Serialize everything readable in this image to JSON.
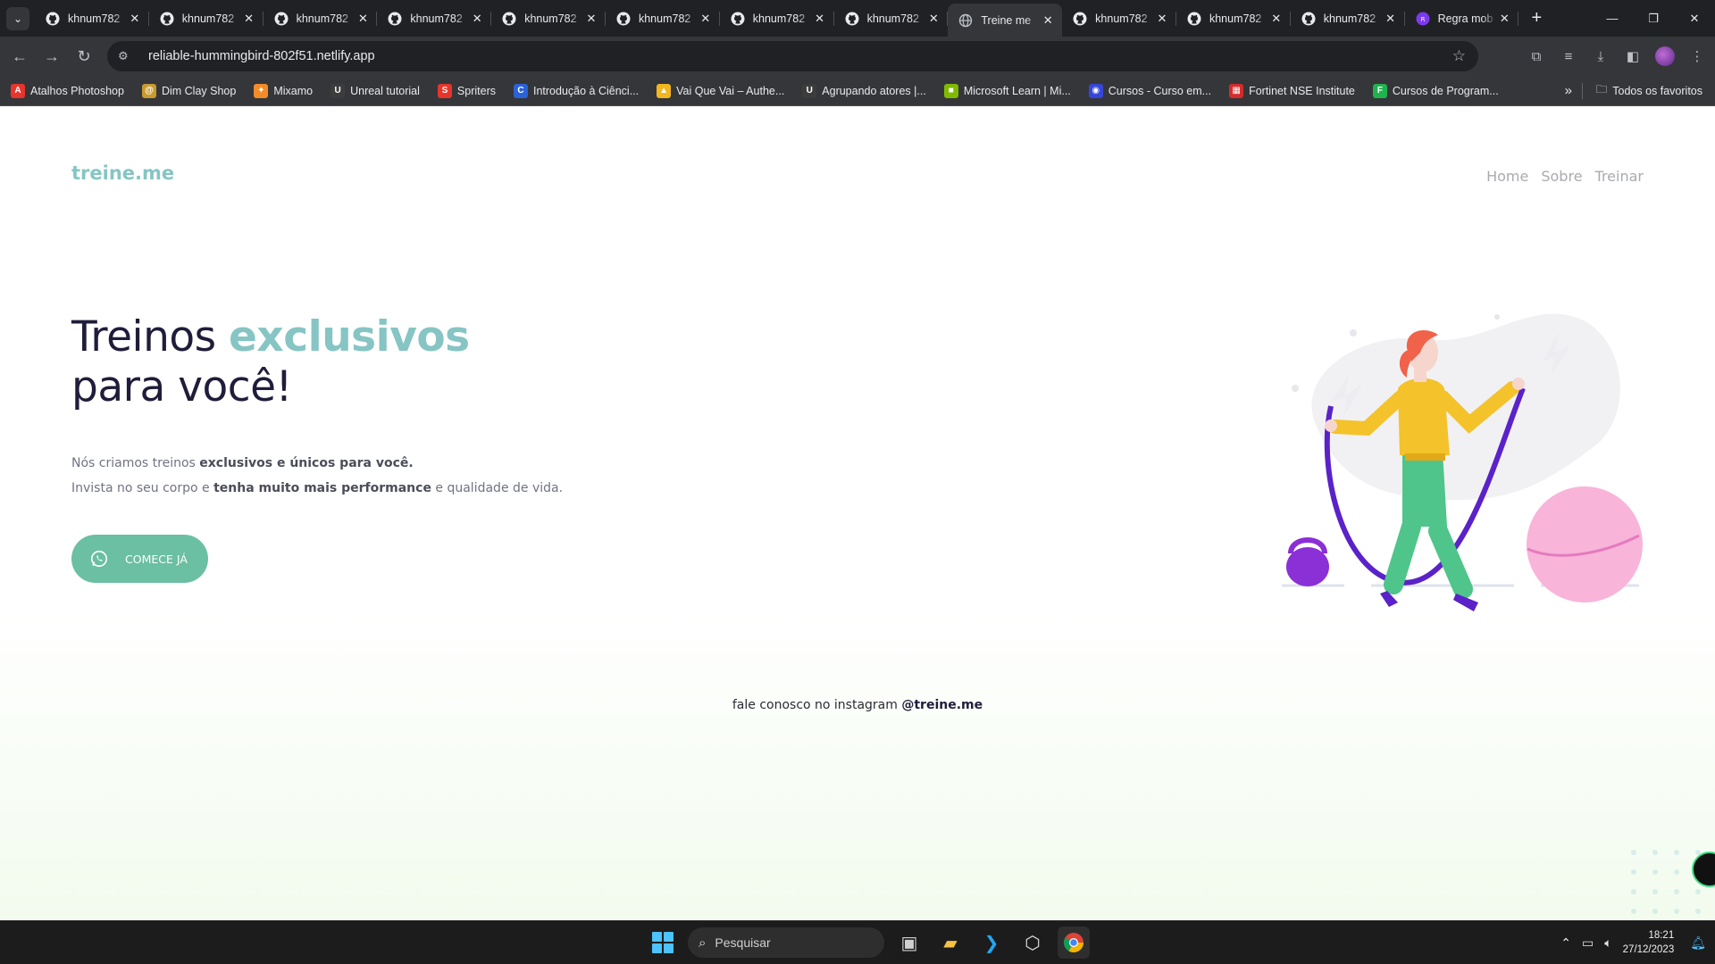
{
  "browser": {
    "tabs": [
      {
        "title": "khnum782",
        "icon": "github-icon",
        "active": false
      },
      {
        "title": "khnum782",
        "icon": "github-icon",
        "active": false
      },
      {
        "title": "khnum782",
        "icon": "github-icon",
        "active": false
      },
      {
        "title": "khnum782",
        "icon": "github-icon",
        "active": false
      },
      {
        "title": "khnum782",
        "icon": "github-icon",
        "active": false
      },
      {
        "title": "khnum782",
        "icon": "github-icon",
        "active": false
      },
      {
        "title": "khnum782",
        "icon": "github-icon",
        "active": false
      },
      {
        "title": "khnum782",
        "icon": "github-icon",
        "active": false
      },
      {
        "title": "Treine me",
        "icon": "globe-icon",
        "active": true
      },
      {
        "title": "khnum782",
        "icon": "github-icon",
        "active": false
      },
      {
        "title": "khnum782",
        "icon": "github-icon",
        "active": false
      },
      {
        "title": "khnum782",
        "icon": "github-icon",
        "active": false
      },
      {
        "title": "Regra mob",
        "icon": "app-icon",
        "active": false
      }
    ],
    "url": "reliable-hummingbird-802f51.netlify.app",
    "bookmarks": [
      {
        "label": "Atalhos Photoshop",
        "color": "#e8352b",
        "glyph": "A"
      },
      {
        "label": "Dim Clay Shop",
        "color": "#c99a2e",
        "glyph": "@"
      },
      {
        "label": "Mixamo",
        "color": "#f28c28",
        "glyph": "✦"
      },
      {
        "label": "Unreal tutorial",
        "color": "#3c3c3c",
        "glyph": "U"
      },
      {
        "label": "Spriters",
        "color": "#e8352b",
        "glyph": "S"
      },
      {
        "label": "Introdução à Ciênci...",
        "color": "#2a62d8",
        "glyph": "C"
      },
      {
        "label": "Vai Que Vai – Authe...",
        "color": "#f2b61f",
        "glyph": "▲"
      },
      {
        "label": "Agrupando atores |...",
        "color": "#3c3c3c",
        "glyph": "U"
      },
      {
        "label": "Microsoft Learn | Mi...",
        "color": "#7fba00",
        "glyph": "■"
      },
      {
        "label": "Cursos - Curso em...",
        "color": "#3546d8",
        "glyph": "◉"
      },
      {
        "label": "Fortinet NSE Institute",
        "color": "#d62b2b",
        "glyph": "▦"
      },
      {
        "label": "Cursos de Program...",
        "color": "#1fb34e",
        "glyph": "F"
      }
    ],
    "bookmarks_all": "Todos os favoritos"
  },
  "site": {
    "logo": "treine.me",
    "nav": [
      "Home",
      "Sobre",
      "Treinar"
    ],
    "hero": {
      "title_line1_a": "Treinos ",
      "title_line1_b": "exclusivos",
      "title_line2": "para você!",
      "p1_a": "Nós criamos treinos ",
      "p1_b": "exclusivos e únicos para você.",
      "p2_a": "Invista no seu corpo e ",
      "p2_b": "tenha muito mais performance",
      "p2_c": " e qualidade de vida.",
      "cta": "COMECE JÁ"
    },
    "footer_a": "fale conosco no instagram ",
    "footer_b": "@treine.me"
  },
  "taskbar": {
    "search_placeholder": "Pesquisar",
    "time": "18:21",
    "date": "27/12/2023"
  }
}
